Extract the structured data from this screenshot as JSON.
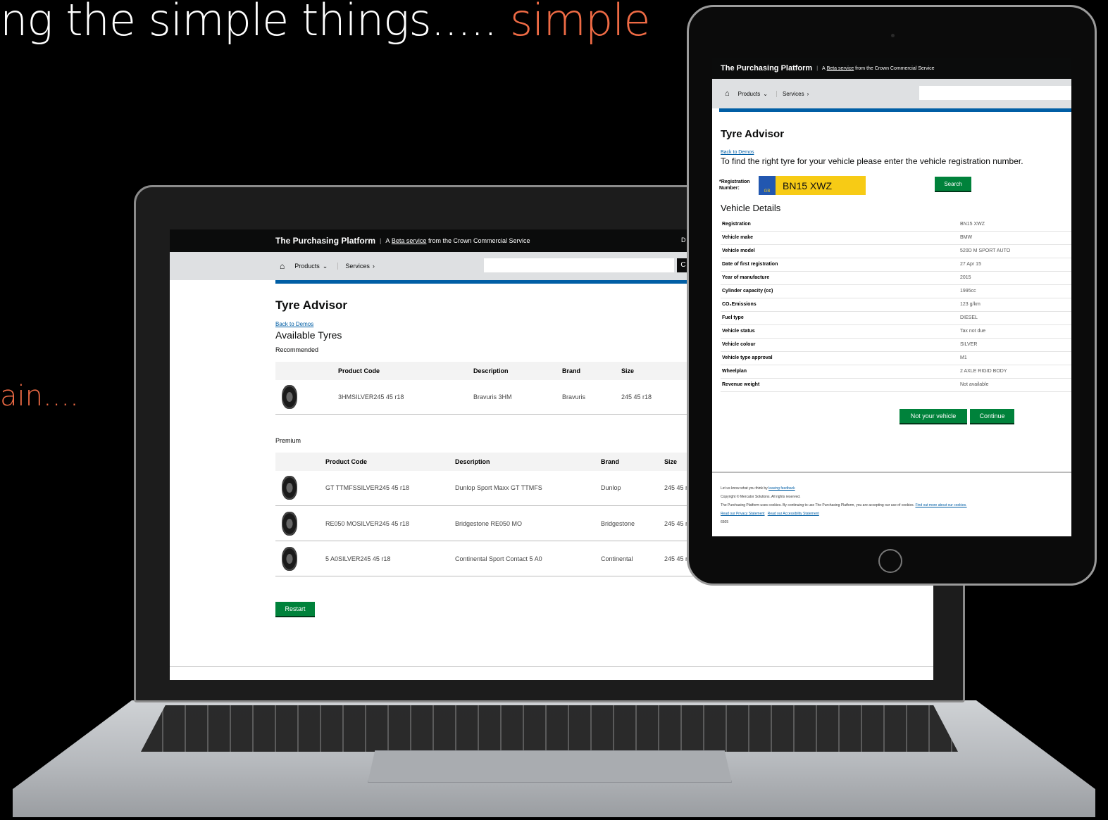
{
  "slide": {
    "title_prefix": "ng the simple things.....",
    "title_accent": "simple",
    "fragment": "ain...."
  },
  "colors": {
    "accent": "#ef6b45",
    "gov_blue": "#005ea5",
    "gov_green": "#00823b",
    "header_black": "#0b0c0c"
  },
  "laptop": {
    "header": {
      "brand": "The Purchasing Platform",
      "sep": "|",
      "beta_prefix": "A",
      "beta_link": "Beta service",
      "beta_suffix": "from the Crown Commercial Service",
      "right_edge": "D"
    },
    "nav": {
      "home_icon": "home-icon",
      "products": "Products",
      "services": "Services",
      "search_placeholder": "",
      "search_btn_fragment": "C"
    },
    "page_title": "Tyre Advisor",
    "back_link": "Back to Demos",
    "subtitle": "Available Tyres",
    "recommended_label": "Recommended",
    "premium_label": "Premium",
    "columns": [
      "Product Code",
      "Description",
      "Brand",
      "Size"
    ],
    "recommended": [
      {
        "code": "3HMSILVER245 45 r18",
        "description": "Bravuris 3HM",
        "brand": "Bravuris",
        "size": "245 45 r18"
      }
    ],
    "premium": [
      {
        "code": "GT TTMFSSILVER245 45 r18",
        "description": "Dunlop Sport Maxx GT TTMFS",
        "brand": "Dunlop",
        "size": "245 45 r1"
      },
      {
        "code": "RE050 MOSILVER245 45 r18",
        "description": "Bridgestone RE050 MO",
        "brand": "Bridgestone",
        "size": "245 45 r1"
      },
      {
        "code": "5 A0SILVER245 45 r18",
        "description": "Continental Sport Contact 5 A0",
        "brand": "Continental",
        "size": "245 45 r18"
      }
    ],
    "restart": "Restart"
  },
  "tablet": {
    "header": {
      "brand": "The Purchasing Platform",
      "sep": "|",
      "beta_prefix": "A",
      "beta_link": "Beta service",
      "beta_suffix": "from the Crown Commercial Service"
    },
    "nav": {
      "products": "Products",
      "services": "Services"
    },
    "page_title": "Tyre Advisor",
    "back_link": "Back to Demos",
    "instruction": "To find the right tyre for your vehicle please enter the vehicle registration number.",
    "reg_label": "*Registration Number:",
    "reg_country": "GB",
    "reg_value": "BN15 XWZ",
    "search": "Search",
    "details_heading": "Vehicle Details",
    "details": [
      {
        "label": "Registration",
        "value": "BN15 XWZ"
      },
      {
        "label": "Vehicle make",
        "value": "BMW"
      },
      {
        "label": "Vehicle model",
        "value": "520D M SPORT AUTO"
      },
      {
        "label": "Date of first registration",
        "value": "27 Apr 15"
      },
      {
        "label": "Year of manufacture",
        "value": "2015"
      },
      {
        "label": "Cylinder capacity (cc)",
        "value": "1995cc"
      },
      {
        "label": "CO₂Emissions",
        "value": "123 g/km"
      },
      {
        "label": "Fuel type",
        "value": "DIESEL"
      },
      {
        "label": "Vehicle status",
        "value": "Tax not due"
      },
      {
        "label": "Vehicle colour",
        "value": "SILVER"
      },
      {
        "label": "Vehicle type approval",
        "value": "M1"
      },
      {
        "label": "Wheelplan",
        "value": "2 AXLE RIGID BODY"
      },
      {
        "label": "Revenue weight",
        "value": "Not available"
      }
    ],
    "not_your_vehicle": "Not your vehicle",
    "continue": "Continue",
    "footer": {
      "feedback_prefix": "Let us know what you think by",
      "feedback_link": "leaving feedback",
      "copyright": "Copyright © Mercator Solutions. All rights reserved.",
      "cookies_text": "The Purchasing Platform uses cookies. By continuing to use The Purchasing Platform, you are accepting our use of cookies.",
      "cookies_link": "Find out more about our cookies.",
      "privacy_link": "Read our Privacy Statement",
      "accessibility_link": "Read our Accessibility Statement",
      "code": "6505"
    }
  }
}
